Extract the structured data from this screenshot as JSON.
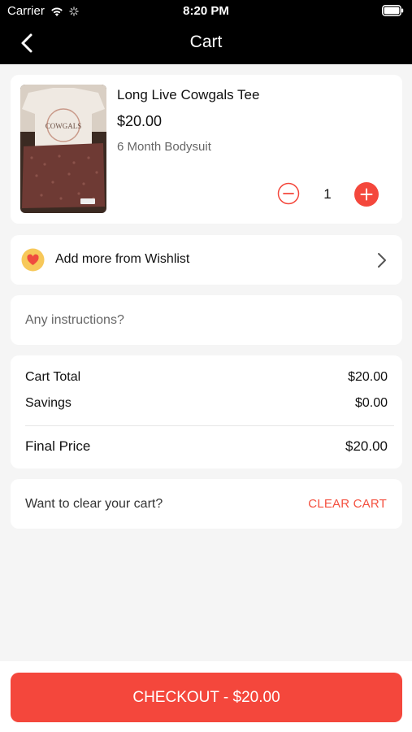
{
  "status_bar": {
    "carrier": "Carrier",
    "time": "8:20 PM"
  },
  "nav": {
    "title": "Cart",
    "back_icon": "chevron-left-icon"
  },
  "cart_item": {
    "name": "Long Live Cowgals Tee",
    "price": "$20.00",
    "variant": "6 Month Bodysuit",
    "quantity": "1",
    "image_text": "COWGALS"
  },
  "wishlist": {
    "label": "Add more from Wishlist",
    "icon": "heart-icon"
  },
  "instructions": {
    "placeholder": "Any instructions?"
  },
  "summary": {
    "cart_total_label": "Cart Total",
    "cart_total_value": "$20.00",
    "savings_label": "Savings",
    "savings_value": "$0.00",
    "final_price_label": "Final Price",
    "final_price_value": "$20.00"
  },
  "clear_cart": {
    "prompt": "Want to clear your cart?",
    "button_label": "CLEAR CART"
  },
  "checkout": {
    "label": "CHECKOUT - $20.00"
  },
  "colors": {
    "accent": "#f4473c",
    "nav_bg": "#000000",
    "page_bg": "#f5f5f5"
  }
}
